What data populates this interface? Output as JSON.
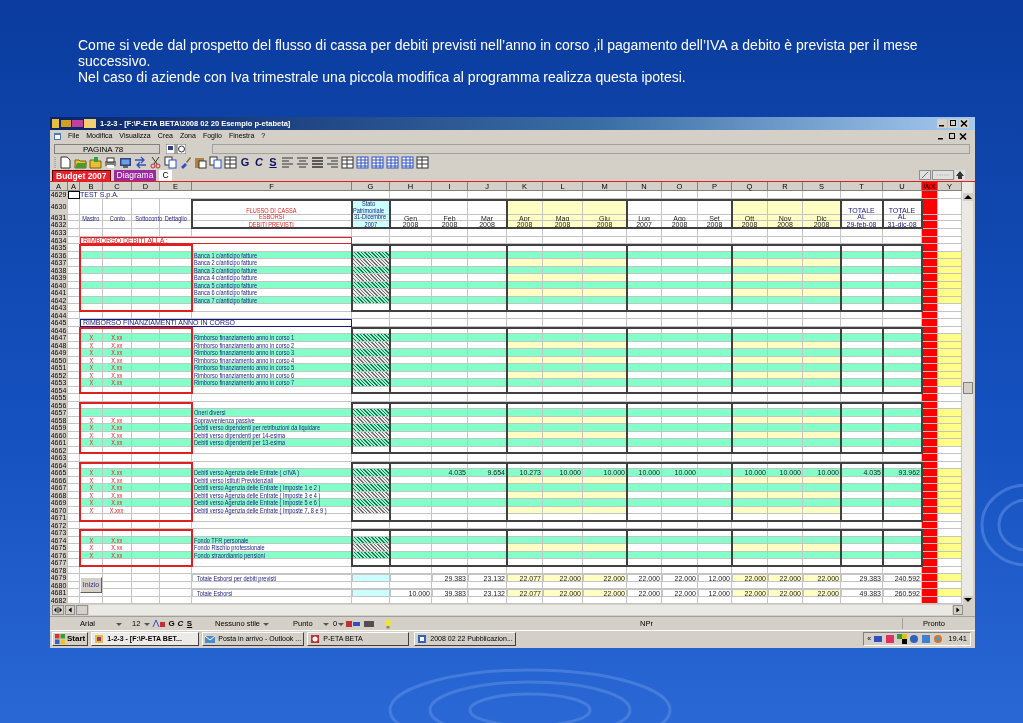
{
  "slide": {
    "paragraphs": [
      "Come si vede dal prospetto del flusso di cassa per debiti previsti nell’anno in corso ,il pagamento dell’IVA a debito è prevista per il mese successivo.",
      "Nel caso di aziende con Iva trimestrale una piccola modifica al programma realizza questa ipotesi."
    ]
  },
  "window": {
    "title": "1-2-3 - [F:\\P-ETA BETA\\2008 02 20  Esempio p-etabeta]"
  },
  "menu": [
    "File",
    "Modifica",
    "Visualizza",
    "Crea",
    "Zona",
    "Foglio",
    "Finestra",
    "?"
  ],
  "name_box": "PAGINA 78",
  "toolbar_text": [
    "G",
    "C",
    "S"
  ],
  "sheet_tabs": [
    {
      "label": "Budget 2007",
      "selected": true,
      "color": "#e8202a"
    },
    {
      "label": "Diagrama",
      "selected": false,
      "color": "#9a2a9e"
    },
    {
      "label": "C",
      "selected": false
    }
  ],
  "column_headers": [
    "A",
    "A",
    "B",
    "C",
    "D",
    "E",
    "F",
    "G",
    "H",
    "I",
    "J",
    "K",
    "L",
    "M",
    "N",
    "O",
    "P",
    "Q",
    "R",
    "S",
    "T",
    "U",
    "WX",
    "Y"
  ],
  "company_row": {
    "num": "4629",
    "label": "TEST S.p.A."
  },
  "header": {
    "rows": [
      "4630",
      "4631",
      "4632"
    ],
    "key_columns": [
      "Mastro",
      "Conto",
      "Sottoconto",
      "Dettaglio"
    ],
    "title_lines": [
      "FLUSSO DI CASSA",
      "ESBORSI",
      "DEBITI PREVISTI"
    ],
    "opening": {
      "title": "Stato Patrimoniale",
      "date": "31-Dicembre",
      "year": "2007"
    },
    "months": [
      {
        "month": "Gen",
        "year": "2008"
      },
      {
        "month": "Feb",
        "year": "2008"
      },
      {
        "month": "Mar",
        "year": "2008"
      },
      {
        "month": "Apr",
        "year": "2008"
      },
      {
        "month": "Mag",
        "year": "2008"
      },
      {
        "month": "Giu",
        "year": "2008"
      },
      {
        "month": "Lug",
        "year": "2007"
      },
      {
        "month": "Ago",
        "year": "2008"
      },
      {
        "month": "Set",
        "year": "2008"
      },
      {
        "month": "Ott",
        "year": "2008"
      },
      {
        "month": "Nov",
        "year": "2008"
      },
      {
        "month": "Dic",
        "year": "2008"
      }
    ],
    "totals": [
      {
        "title": "TOTALE",
        "prefix": "AL",
        "date": "29-feb-08"
      },
      {
        "title": "TOTALE",
        "prefix": "AL",
        "date": "31-dic-08"
      }
    ]
  },
  "groups": [
    {
      "kind": "gap",
      "rows": [
        {
          "num": "4633",
          "kind": "blank"
        },
        {
          "num": "4634",
          "kind": "section",
          "label": "RIMBORSO DEBITI ALLA :",
          "color": "#e02020"
        }
      ]
    },
    {
      "kind": "block",
      "rows": [
        {
          "num": "4635",
          "kind": "blank"
        },
        {
          "num": "4636",
          "kind": "item",
          "highlighted": true,
          "label": "Banca 1 c/anticipo fatture"
        },
        {
          "num": "4637",
          "kind": "item",
          "highlighted": false,
          "label": "Banca 2 c/anticipo fatture"
        },
        {
          "num": "4638",
          "kind": "item",
          "highlighted": true,
          "label": "Banca 3 c/anticipo fatture"
        },
        {
          "num": "4639",
          "kind": "item",
          "highlighted": false,
          "label": "Banca 4 c/anticipo fatture"
        },
        {
          "num": "4640",
          "kind": "item",
          "highlighted": true,
          "label": "Banca 5 c/anticipo fatture"
        },
        {
          "num": "4641",
          "kind": "item",
          "highlighted": false,
          "label": "Banca 6 c/anticipo fatture"
        },
        {
          "num": "4642",
          "kind": "item",
          "highlighted": true,
          "label": "Banca 7 c/anticipo fatture"
        },
        {
          "num": "4643",
          "kind": "blank"
        }
      ]
    },
    {
      "kind": "gap",
      "rows": [
        {
          "num": "4644",
          "kind": "blank"
        },
        {
          "num": "4645",
          "kind": "section",
          "label": "RIMBORSO FINANZIAMENTI ANNO IN CORSO",
          "color": "#1a1a80"
        }
      ]
    },
    {
      "kind": "block",
      "rows": [
        {
          "num": "4646",
          "kind": "blank"
        },
        {
          "num": "4647",
          "kind": "item",
          "highlighted": true,
          "mastro": "X",
          "conto": "X.xx",
          "label": "Rimborso finanziamento anno in corso 1"
        },
        {
          "num": "4648",
          "kind": "item",
          "highlighted": false,
          "mastro": "X",
          "conto": "X.xx",
          "label": "Rimborso finanziamento anno in corso 2"
        },
        {
          "num": "4649",
          "kind": "item",
          "highlighted": true,
          "mastro": "X",
          "conto": "X.xx",
          "label": "Rimborso finanziamento anno in corso 3"
        },
        {
          "num": "4650",
          "kind": "item",
          "highlighted": false,
          "mastro": "X",
          "conto": "X.xx",
          "label": "Rimborso finanziamento anno in corso 4"
        },
        {
          "num": "4651",
          "kind": "item",
          "highlighted": true,
          "mastro": "X",
          "conto": "X.xx",
          "label": "Rimborso finanziamento anno in corso 5"
        },
        {
          "num": "4652",
          "kind": "item",
          "highlighted": false,
          "mastro": "X",
          "conto": "X.xx",
          "label": "Rimborso finanziamento anno in corso 6"
        },
        {
          "num": "4653",
          "kind": "item",
          "highlighted": true,
          "mastro": "X",
          "conto": "X.xx",
          "label": "Rimborso finanziamento anno in corso 7"
        },
        {
          "num": "4654",
          "kind": "blank"
        }
      ]
    },
    {
      "kind": "gap",
      "rows": [
        {
          "num": "4655",
          "kind": "blank"
        }
      ]
    },
    {
      "kind": "block",
      "rows": [
        {
          "num": "4656",
          "kind": "blank"
        },
        {
          "num": "4657",
          "kind": "item",
          "highlighted": true,
          "label": "Oneri diversi"
        },
        {
          "num": "4658",
          "kind": "item",
          "highlighted": false,
          "mastro": "X",
          "conto": "X.xx",
          "label": "Sopravvenienza passive"
        },
        {
          "num": "4659",
          "kind": "item",
          "highlighted": true,
          "mastro": "X",
          "conto": "X.xx",
          "label": "Debiti verso dipendenti per retribuzioni da liquidare"
        },
        {
          "num": "4660",
          "kind": "item",
          "highlighted": false,
          "mastro": "X",
          "conto": "X.xx",
          "label": "Debiti verso dipendenti per 14-esima"
        },
        {
          "num": "4661",
          "kind": "item",
          "highlighted": true,
          "mastro": "X",
          "conto": "X.xx",
          "label": "Debiti verso dipendenti per 13-esima"
        },
        {
          "num": "4662",
          "kind": "blank"
        }
      ]
    },
    {
      "kind": "gap",
      "rows": [
        {
          "num": "4663",
          "kind": "blank"
        }
      ]
    },
    {
      "kind": "block",
      "rows": [
        {
          "num": "4664",
          "kind": "blank"
        },
        {
          "num": "4665",
          "kind": "item",
          "highlighted": true,
          "mastro": "X",
          "conto": "X.xx",
          "label": "Debiti verso Agenzia delle Entrate  ( c/IVA )",
          "values": {
            "I": "4.035",
            "J": "9.654",
            "K": "10.273",
            "L": "10.000",
            "M": "10.000",
            "N": "10.000",
            "O": "10.000",
            "Q": "10.000",
            "R": "10.000",
            "S": "10.000",
            "T": "4.035",
            "U": "93.962"
          }
        },
        {
          "num": "4666",
          "kind": "item",
          "highlighted": false,
          "mastro": "X",
          "conto": "X.xx",
          "label": "Debiti verso Istituti Previdenziali"
        },
        {
          "num": "4667",
          "kind": "item",
          "highlighted": true,
          "mastro": "X",
          "conto": "X.xx",
          "label": "Debiti verso Agenzia delle Entrate ( Imposte 1  e  2  )"
        },
        {
          "num": "4668",
          "kind": "item",
          "highlighted": false,
          "mastro": "X",
          "conto": "X.xx",
          "label": "Debiti verso Agenzia delle Entrate ( Imposte 3 e  4  )"
        },
        {
          "num": "4669",
          "kind": "item",
          "highlighted": true,
          "mastro": "X",
          "conto": "X.xx",
          "label": "Debiti verso Agenzia delle Entrate ( Imposte  5 e  6  )"
        },
        {
          "num": "4670",
          "kind": "item",
          "highlighted": false,
          "mastro": "X",
          "conto": "X.xxx",
          "label": "Debiti verso Agenzia delle Entrate ( Imposte 7, 8  e 9  )"
        },
        {
          "num": "4671",
          "kind": "blank"
        }
      ]
    },
    {
      "kind": "gap",
      "rows": [
        {
          "num": "4672",
          "kind": "blank"
        }
      ]
    },
    {
      "kind": "block",
      "rows": [
        {
          "num": "4673",
          "kind": "blank"
        },
        {
          "num": "4674",
          "kind": "item",
          "highlighted": true,
          "mastro": "X",
          "conto": "X.xx",
          "label": "Fondo TFR personale"
        },
        {
          "num": "4675",
          "kind": "item",
          "highlighted": false,
          "mastro": "X",
          "conto": "X.xx",
          "label": "Fondo Rischio professionale"
        },
        {
          "num": "4676",
          "kind": "item",
          "highlighted": true,
          "mastro": "X",
          "conto": "X.xx",
          "label": "Fondo straordianrio pensioni"
        },
        {
          "num": "4677",
          "kind": "blank"
        }
      ]
    },
    {
      "kind": "gap",
      "rows": [
        {
          "num": "4678",
          "kind": "blank"
        }
      ]
    },
    {
      "kind": "totals",
      "button": "Inizio",
      "rows": [
        {
          "num": "4679",
          "kind": "total",
          "label": "Totale Esborsi per debiti previsti",
          "values": {
            "I": "29.383",
            "J": "23.132",
            "K": "22.077",
            "L": "22.000",
            "M": "22.000",
            "N": "22.000",
            "O": "22.000",
            "P": "12.000",
            "Q": "22.000",
            "R": "22.000",
            "S": "22.000",
            "T": "29.383",
            "U": "240.592"
          }
        },
        {
          "num": "4680",
          "kind": "blank"
        },
        {
          "num": "4681",
          "kind": "total",
          "label": "Totale Esborsi",
          "values": {
            "H": "10.000",
            "I": "39.383",
            "J": "23.132",
            "K": "22.077",
            "L": "22.000",
            "M": "22.000",
            "N": "22.000",
            "O": "22.000",
            "P": "12.000",
            "Q": "22.000",
            "R": "22.000",
            "S": "22.000",
            "T": "49.383",
            "U": "260.592"
          }
        },
        {
          "num": "4682",
          "kind": "blank"
        }
      ]
    }
  ],
  "status_bar": {
    "font": "Arial",
    "size": "12",
    "format_text": [
      "G",
      "C",
      "S"
    ],
    "style": "Nessuno stile",
    "number_format": "Punto",
    "decimals": "0",
    "mode": "NPr",
    "state": "Pronto"
  },
  "taskbar": {
    "start": "Start",
    "tasks": [
      "1-2-3 - [F:\\P-ETA BET...",
      "Posta in arrivo - Outlook ...",
      "P-ETA BETA",
      "2008 02 22 Pubblicazion..."
    ],
    "tray_arrow": "«",
    "clock": "19.41"
  }
}
